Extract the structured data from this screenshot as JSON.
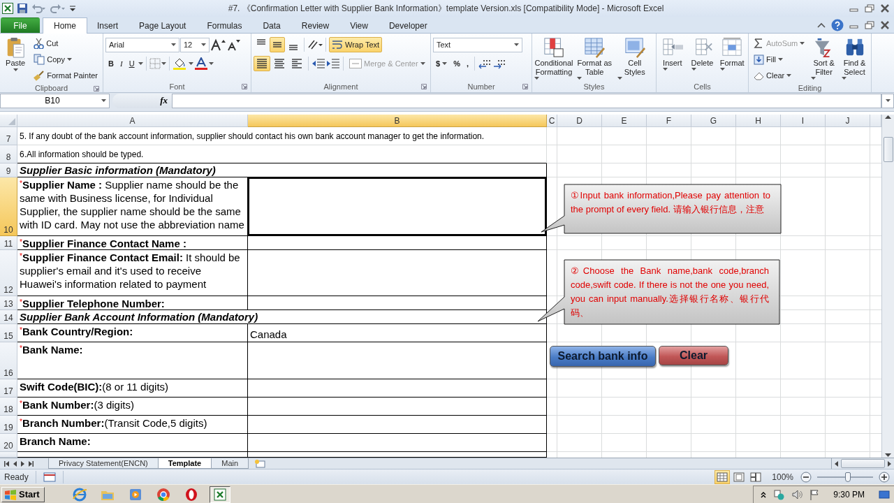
{
  "window": {
    "title": "#7. 《Confirmation Letter with Supplier Bank Information》template Version.xls  [Compatibility Mode]  -  Microsoft Excel"
  },
  "ribbon_tabs": [
    {
      "kind": "file",
      "label": "File",
      "selected": false
    },
    {
      "kind": "tab",
      "label": "Home",
      "selected": true
    },
    {
      "kind": "tab",
      "label": "Insert",
      "selected": false
    },
    {
      "kind": "tab",
      "label": "Page Layout",
      "selected": false
    },
    {
      "kind": "tab",
      "label": "Formulas",
      "selected": false
    },
    {
      "kind": "tab",
      "label": "Data",
      "selected": false
    },
    {
      "kind": "tab",
      "label": "Review",
      "selected": false
    },
    {
      "kind": "tab",
      "label": "View",
      "selected": false
    },
    {
      "kind": "tab",
      "label": "Developer",
      "selected": false
    }
  ],
  "clipboard": {
    "label": "Clipboard",
    "paste": "Paste",
    "cut": "Cut",
    "copy": "Copy",
    "format_painter": "Format Painter"
  },
  "font": {
    "label": "Font",
    "name": "Arial",
    "size": "12",
    "styles": [
      "B",
      "I",
      "U"
    ]
  },
  "alignment": {
    "label": "Alignment",
    "vertical": [
      {
        "kind": "top",
        "selected": false
      },
      {
        "kind": "middle",
        "selected": true
      },
      {
        "kind": "bottom",
        "selected": false
      }
    ],
    "horizontal": [
      {
        "kind": "left",
        "selected": true
      },
      {
        "kind": "center",
        "selected": false
      },
      {
        "kind": "right",
        "selected": false
      }
    ],
    "wrap_text": {
      "label": "Wrap Text",
      "on": true
    },
    "merge": {
      "label": "Merge & Center",
      "disabled": true
    }
  },
  "number": {
    "label": "Number",
    "format": "Text",
    "symbols": [
      "$",
      "%",
      ","
    ]
  },
  "styles": {
    "label": "Styles",
    "buttons": [
      {
        "kind": "conditional",
        "label": "Conditional Formatting"
      },
      {
        "kind": "table",
        "label": "Format as Table"
      },
      {
        "kind": "cellstyles",
        "label": "Cell Styles"
      }
    ]
  },
  "cells": {
    "label": "Cells",
    "buttons": [
      {
        "kind": "insert",
        "label": "Insert"
      },
      {
        "kind": "delete",
        "label": "Delete"
      },
      {
        "kind": "format",
        "label": "Format"
      }
    ]
  },
  "editing": {
    "label": "Editing",
    "small": [
      {
        "kind": "autosum",
        "label": "AutoSum",
        "disabled": true
      },
      {
        "kind": "fill",
        "label": "Fill",
        "disabled": false
      },
      {
        "kind": "clear",
        "label": "Clear",
        "disabled": false
      }
    ],
    "large": [
      {
        "kind": "sort",
        "label": "Sort & Filter"
      },
      {
        "kind": "find",
        "label": "Find & Select"
      }
    ]
  },
  "formula_bar": {
    "name_box": "B10",
    "function_label": "fx"
  },
  "sheet": {
    "columns": [
      {
        "label": "A",
        "selected": false
      },
      {
        "label": "B",
        "selected": true
      },
      {
        "label": "C",
        "selected": false
      },
      {
        "label": "D",
        "selected": false
      },
      {
        "label": "E",
        "selected": false
      },
      {
        "label": "F",
        "selected": false
      },
      {
        "label": "G",
        "selected": false
      },
      {
        "label": "H",
        "selected": false
      },
      {
        "label": "I",
        "selected": false
      },
      {
        "label": "J",
        "selected": false
      }
    ],
    "rows": [
      {
        "number": "7",
        "kind": "note",
        "text": "5. If any doubt of the bank account information, supplier should contact his own bank account manager to get the information.",
        "selected": false
      },
      {
        "number": "8",
        "kind": "note",
        "text": "6.All information should be typed.",
        "selected": false
      },
      {
        "number": "9",
        "kind": "section",
        "text": "Supplier Basic information (Mandatory)",
        "selected": false
      },
      {
        "number": "10",
        "kind": "field",
        "text": "$^{*}$**Supplier Name :** Supplier name should be the same with Business license, for Individual Supplier, the supplier name should be the same with ID card. May not use the abbreviation name",
        "selected": true
      },
      {
        "number": "11",
        "kind": "field",
        "text": "$^{*}$**Supplier Finance Contact Name :**",
        "selected": false
      },
      {
        "number": "12",
        "kind": "field",
        "text": "$^{*}$**Supplier Finance Contact Email:** It should be supplier's email and it's used to receive Huawei's information related to payment",
        "selected": false
      },
      {
        "number": "13",
        "kind": "field",
        "text": "$^{*}$**Supplier Telephone Number:**",
        "selected": false
      },
      {
        "number": "14",
        "kind": "section",
        "text": "Supplier Bank Account Information (Mandatory)",
        "selected": false
      },
      {
        "number": "15",
        "kind": "field",
        "text": "$^{*}$**Bank Country/Region:**",
        "value": "Canada",
        "selected": false
      },
      {
        "number": "16",
        "kind": "field",
        "text": "$^{*}$**Bank Name:**",
        "selected": false
      },
      {
        "number": "17",
        "kind": "field",
        "text": "**Swift Code(BIC):**(8 or 11 digits)",
        "selected": false
      },
      {
        "number": "18",
        "kind": "field",
        "text": "$^{*}$**Bank Number:**(3 digits)",
        "selected": false
      },
      {
        "number": "19",
        "kind": "field",
        "text": "$^{*}$**Branch Number:**(Transit Code,5 digits)",
        "selected": false
      },
      {
        "number": "20",
        "kind": "field",
        "text": "**Branch Name:**",
        "selected": false
      }
    ],
    "callouts": [
      {
        "text": "①Input bank information,Please pay attention to the prompt of every field. 请输入银行信息，注意"
      },
      {
        "text": "②Choose the Bank name,bank code,branch code,swift code. If there is not the one you need, you can input manually.选择银行名称、银行代码、"
      }
    ],
    "buttons": [
      {
        "kind": "search",
        "label": "Search bank info"
      },
      {
        "kind": "clear",
        "label": "Clear"
      }
    ]
  },
  "sheet_tabs": [
    {
      "label": "Privacy Statement(ENCN)",
      "selected": false
    },
    {
      "label": "Template",
      "selected": true
    },
    {
      "label": "Main",
      "selected": false
    }
  ],
  "status_bar": {
    "status": "Ready",
    "views": [
      {
        "kind": "normal",
        "selected": true
      },
      {
        "kind": "page_layout",
        "selected": false
      },
      {
        "kind": "page_break",
        "selected": false
      }
    ],
    "zoom": "100%",
    "zoom_slider": {
      "level": 0.55
    }
  },
  "taskbar": {
    "start": "Start",
    "apps": [
      {
        "kind": "ie",
        "active": false
      },
      {
        "kind": "folder",
        "active": false
      },
      {
        "kind": "media",
        "active": false
      },
      {
        "kind": "chrome",
        "active": false
      },
      {
        "kind": "opera",
        "active": false
      },
      {
        "kind": "excel",
        "active": true
      }
    ],
    "time": "9:30 PM"
  }
}
